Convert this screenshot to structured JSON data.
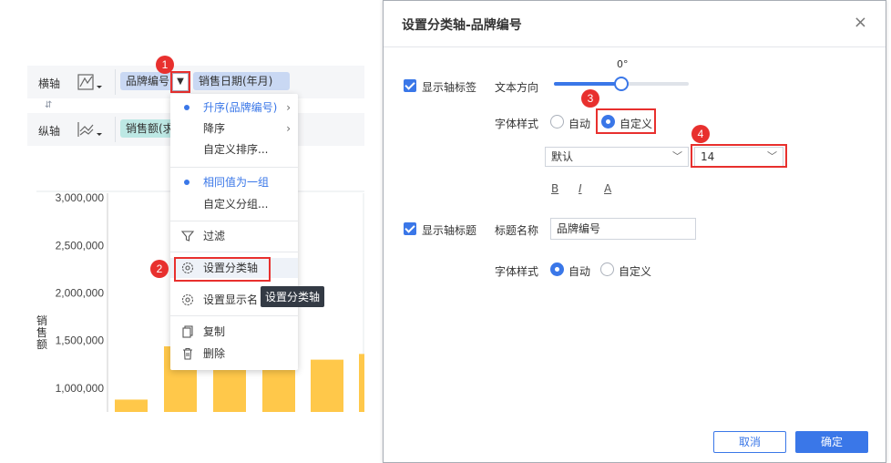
{
  "left": {
    "row_h_label": "横轴",
    "row_v_label": "纵轴",
    "swap_label": "⇵",
    "h_pills": [
      "品牌编号",
      "销售日期(年月)"
    ],
    "v_pills": [
      "销售额(求"
    ],
    "pill_arrow": "▼",
    "badges": [
      "1",
      "2"
    ],
    "menu": {
      "asc": "升序(品牌编号)",
      "desc": "降序",
      "custom_sort": "自定义排序...",
      "same_group": "相同值为一组",
      "custom_group": "自定义分组...",
      "filter": "过滤",
      "set_axis": "设置分类轴",
      "set_display": "设置显示名",
      "copy": "复制",
      "delete": "删除",
      "chevron": "›"
    },
    "tooltip": "设置分类轴"
  },
  "chart_data": {
    "type": "bar",
    "yticks": [
      "3,000,000",
      "2,500,000",
      "2,000,000",
      "1,500,000",
      "1,000,000"
    ],
    "ylabel": "销售额",
    "values": [
      880000,
      1440000,
      1380000,
      1350000,
      1300000,
      1360000
    ],
    "ylim": [
      750000,
      3050000
    ],
    "bar_color": "#ffc84a"
  },
  "dialog": {
    "title": "设置分类轴-品牌编号",
    "close": "×",
    "show_label": "显示轴标签",
    "text_direction": "文本方向",
    "angle": "0°",
    "font_style": "字体样式",
    "auto": "自动",
    "custom": "自定义",
    "font_family": "默认",
    "font_size": "14",
    "bold": "B",
    "italic": "I",
    "color": "A",
    "show_title": "显示轴标题",
    "title_name_label": "标题名称",
    "title_name_value": "品牌编号",
    "font_style2": "字体样式",
    "auto2": "自动",
    "custom2": "自定义",
    "cancel": "取消",
    "ok": "确定",
    "badges": [
      "3",
      "4"
    ],
    "accent": "#3a77e8",
    "highlight": "#e8302e"
  }
}
